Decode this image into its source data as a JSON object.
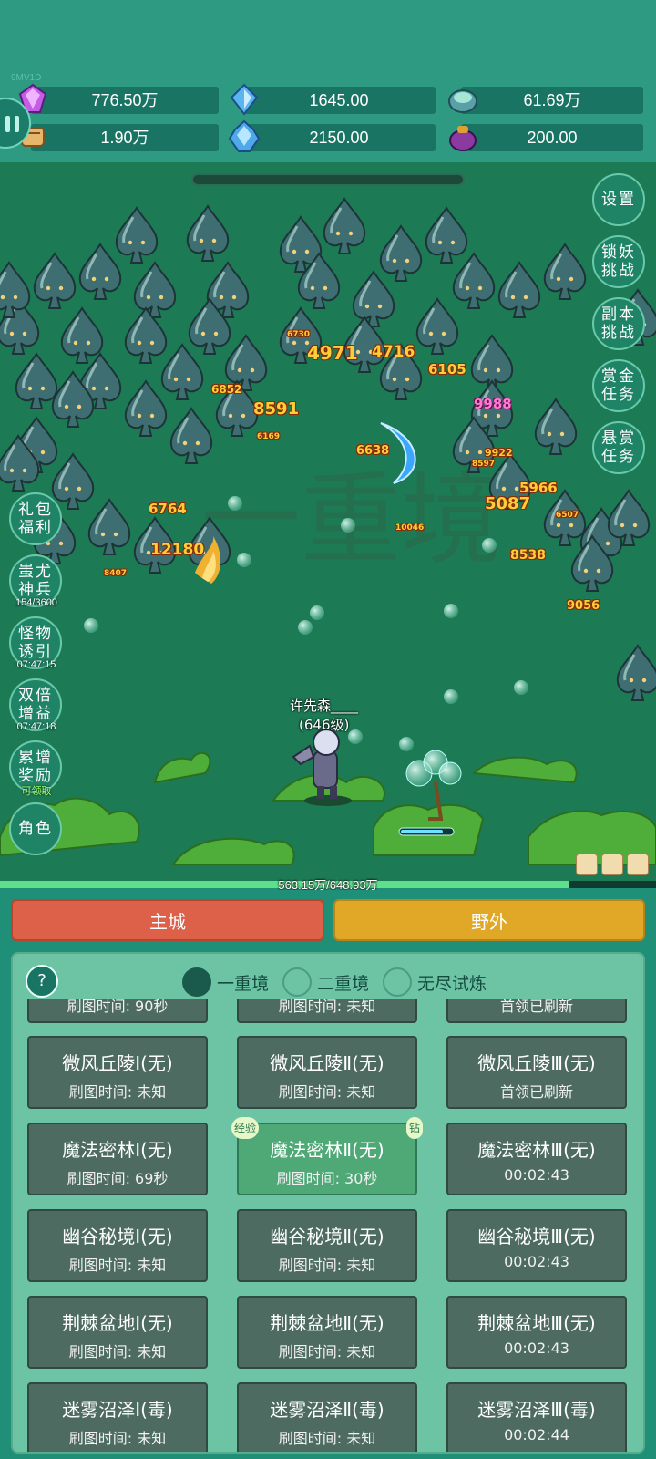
{
  "version": "9MV1D",
  "resources": [
    {
      "icon": "purple-gem-icon",
      "value": "776.50万"
    },
    {
      "icon": "blue-crystal-icon",
      "value": "1645.00"
    },
    {
      "icon": "green-orb-icon",
      "value": "61.69万"
    },
    {
      "icon": "scroll-icon",
      "value": "1.90万"
    },
    {
      "icon": "ice-crystal-icon",
      "value": "2150.00"
    },
    {
      "icon": "pouch-icon",
      "value": "200.00"
    }
  ],
  "right_menu": [
    {
      "label": "设置"
    },
    {
      "label": "锁妖挑战"
    },
    {
      "label": "副本挑战"
    },
    {
      "label": "赏金任务"
    },
    {
      "label": "悬赏任务"
    }
  ],
  "left_menu": [
    {
      "label": "礼包福利",
      "sub": ""
    },
    {
      "label": "蚩尤神兵",
      "sub": "154/3600"
    },
    {
      "label": "怪物诱引",
      "sub": "07:47:15"
    },
    {
      "label": "双倍增益",
      "sub": "07:47:18"
    },
    {
      "label": "累增奖励",
      "sub": "可领取"
    },
    {
      "label": "角色",
      "sub": ""
    }
  ],
  "damage_numbers": [
    "4971",
    "4716",
    "6105",
    "8591",
    "9988",
    "6638",
    "5966",
    "5087",
    "6764",
    "12180",
    "8538",
    "9056",
    "6852",
    "6730",
    "8407",
    "6169",
    "10046",
    "9922",
    "8597",
    "6507"
  ],
  "player": {
    "name": "许先森____",
    "level": "(646级)"
  },
  "experience": {
    "text": "563.15万/648.93万",
    "fraction": 0.868
  },
  "tabs": {
    "main_city": "主城",
    "wild": "野外"
  },
  "panel": {
    "help": "?",
    "realms": [
      {
        "label": "一重境",
        "selected": true
      },
      {
        "label": "二重境",
        "selected": false
      },
      {
        "label": "无尽试炼",
        "selected": false
      }
    ],
    "maps": [
      {
        "title": "",
        "sub": "刷图时间: 90秒",
        "partial": true
      },
      {
        "title": "",
        "sub": "刷图时间: 未知",
        "partial": true
      },
      {
        "title": "",
        "sub": "首领已刷新",
        "partial": true
      },
      {
        "title": "微风丘陵Ⅰ(无)",
        "sub": "刷图时间: 未知"
      },
      {
        "title": "微风丘陵Ⅱ(无)",
        "sub": "刷图时间: 未知"
      },
      {
        "title": "微风丘陵Ⅲ(无)",
        "sub": "首领已刷新"
      },
      {
        "title": "魔法密林Ⅰ(无)",
        "sub": "刷图时间: 69秒"
      },
      {
        "title": "魔法密林Ⅱ(无)",
        "sub": "刷图时间: 30秒",
        "selected": true,
        "badge_left": "经验",
        "badge_right": "钻"
      },
      {
        "title": "魔法密林Ⅲ(无)",
        "sub": "00:02:43"
      },
      {
        "title": "幽谷秘境Ⅰ(无)",
        "sub": "刷图时间: 未知"
      },
      {
        "title": "幽谷秘境Ⅱ(无)",
        "sub": "刷图时间: 未知"
      },
      {
        "title": "幽谷秘境Ⅲ(无)",
        "sub": "00:02:43"
      },
      {
        "title": "荆棘盆地Ⅰ(无)",
        "sub": "刷图时间: 未知"
      },
      {
        "title": "荆棘盆地Ⅱ(无)",
        "sub": "刷图时间: 未知"
      },
      {
        "title": "荆棘盆地Ⅲ(无)",
        "sub": "00:02:43"
      },
      {
        "title": "迷雾沼泽Ⅰ(毒)",
        "sub": "刷图时间: 未知"
      },
      {
        "title": "迷雾沼泽Ⅱ(毒)",
        "sub": "刷图时间: 未知"
      },
      {
        "title": "迷雾沼泽Ⅲ(毒)",
        "sub": "00:02:44"
      }
    ]
  }
}
